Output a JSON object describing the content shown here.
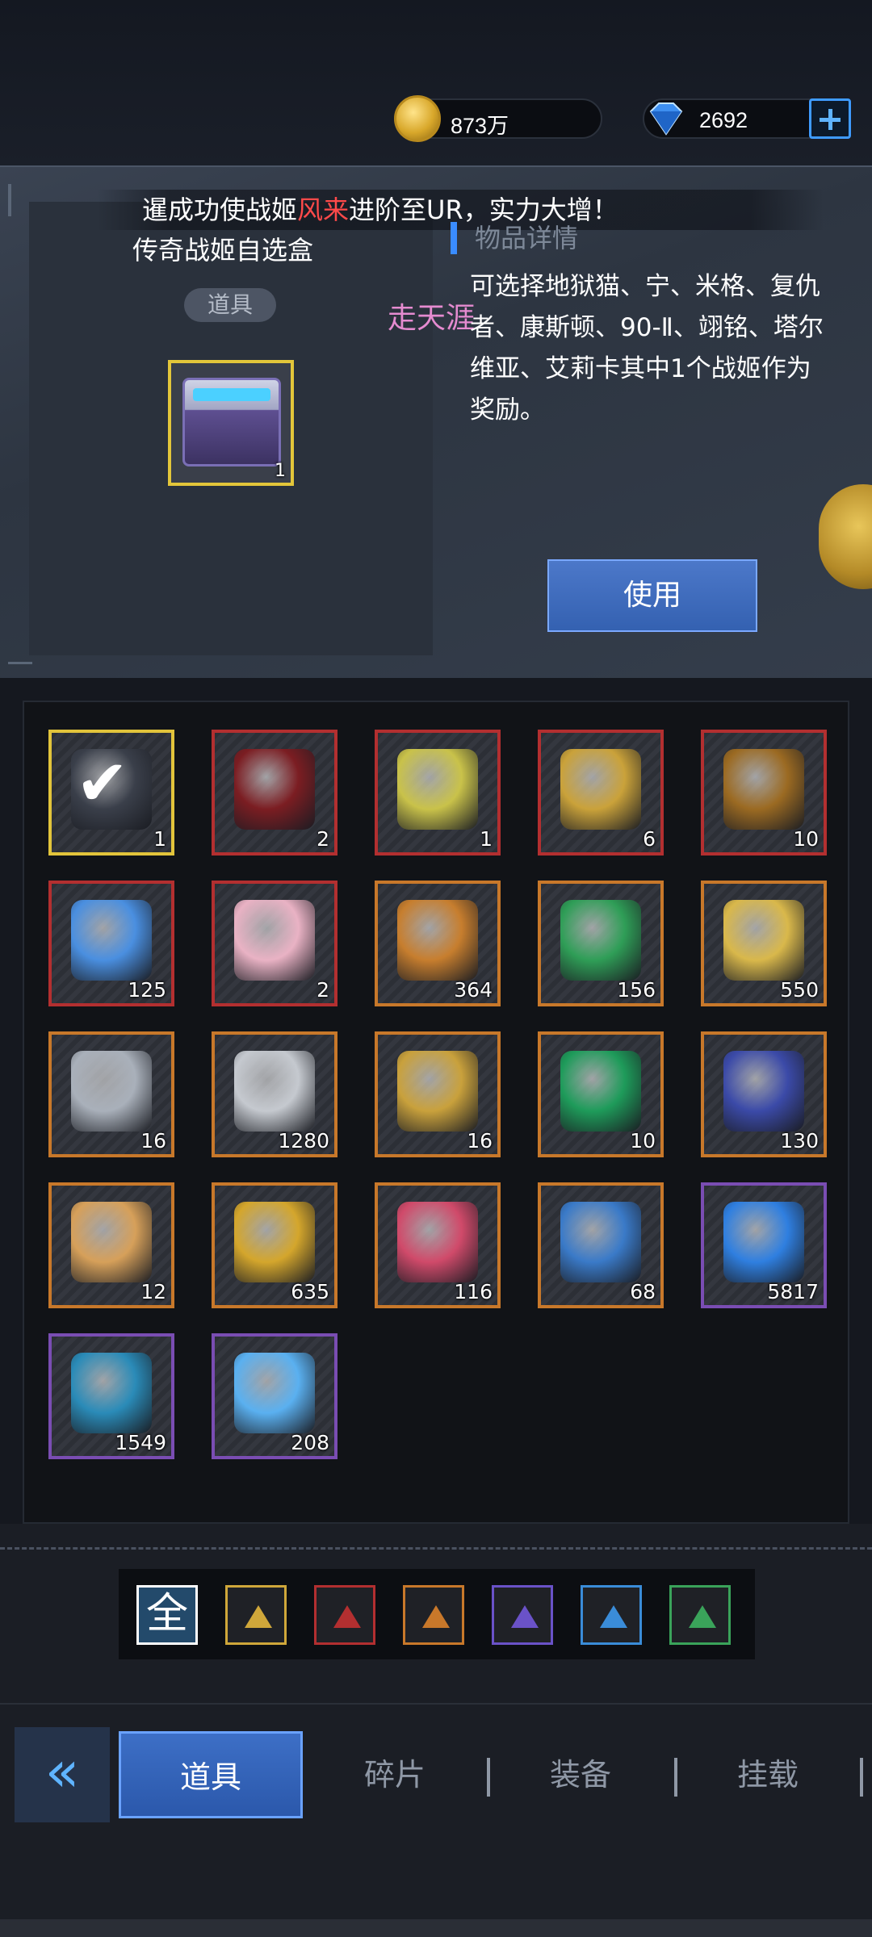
{
  "currency": {
    "gold": "873万",
    "gems": "2692"
  },
  "marquee": {
    "prefix": "暹成功使战姬",
    "highlight": "风来",
    "suffix": "进阶至UR，实力大增！"
  },
  "selected_item": {
    "name": "传奇战姬自选盒",
    "tag": "道具",
    "quantity": "1",
    "detail_heading": "物品详情",
    "description": "可选择地狱猫、宁、米格、复仇者、康斯顿、90-Ⅱ、翊铭、塔尔维亚、艾莉卡其中1个战姬作为奖励。",
    "use_button": "使用"
  },
  "watermark": "走天涯",
  "colors": {
    "accent_blue": "#3a8cff",
    "highlight_red": "#ff4a4a",
    "rarity_yellow": "#e2c43b",
    "rarity_red": "#b32f30",
    "rarity_orange": "#c8782a",
    "rarity_purple": "#7a4db3"
  },
  "inventory": [
    {
      "icon": "chest-selected-icon",
      "qty": "1",
      "rarity": "yellow",
      "color": "#3a3f4a"
    },
    {
      "icon": "red-card-icon",
      "qty": "2",
      "rarity": "red",
      "color": "#7b1d22"
    },
    {
      "icon": "license-ticket-icon",
      "qty": "1",
      "rarity": "red",
      "color": "#c9c24a"
    },
    {
      "icon": "gold-medal-icon",
      "qty": "6",
      "rarity": "red",
      "color": "#caa23a"
    },
    {
      "icon": "fashion-voucher-icon",
      "qty": "10",
      "rarity": "red",
      "color": "#9b6a22"
    },
    {
      "icon": "blue-capsule-icon",
      "qty": "125",
      "rarity": "red",
      "color": "#4a8fe0"
    },
    {
      "icon": "gift-box-icon",
      "qty": "2",
      "rarity": "red",
      "color": "#e9b2c4"
    },
    {
      "icon": "burger-icon",
      "qty": "364",
      "rarity": "orange",
      "color": "#c77e2e"
    },
    {
      "icon": "green-pet-device-icon",
      "qty": "156",
      "rarity": "orange",
      "color": "#2f9e57"
    },
    {
      "icon": "star-badge-icon",
      "qty": "550",
      "rarity": "orange",
      "color": "#d9b84b"
    },
    {
      "icon": "silver-medal-icon",
      "qty": "16",
      "rarity": "orange",
      "color": "#a9b0ba"
    },
    {
      "icon": "shell-stone-icon",
      "qty": "1280",
      "rarity": "orange",
      "color": "#c5c9cf"
    },
    {
      "icon": "blue-gold-coin-icon",
      "qty": "16",
      "rarity": "orange",
      "color": "#c9a13c"
    },
    {
      "icon": "green-crystal-icon",
      "qty": "10",
      "rarity": "orange",
      "color": "#1e9b5a"
    },
    {
      "icon": "gift-coin-icon",
      "qty": "130",
      "rarity": "orange",
      "color": "#3b4aa8"
    },
    {
      "icon": "fried-food-icon",
      "qty": "12",
      "rarity": "orange",
      "color": "#d6a05a"
    },
    {
      "icon": "gold-star-icon",
      "qty": "635",
      "rarity": "orange",
      "color": "#d4a62c"
    },
    {
      "icon": "berry-fruit-icon",
      "qty": "116",
      "rarity": "orange",
      "color": "#d04a6a"
    },
    {
      "icon": "blue-core-icon",
      "qty": "68",
      "rarity": "orange",
      "color": "#3a7ac8"
    },
    {
      "icon": "energy-canister-icon",
      "qty": "5817",
      "rarity": "purple",
      "color": "#2f7fe0"
    },
    {
      "icon": "circuit-board-icon",
      "qty": "1549",
      "rarity": "purple",
      "color": "#2a8bb8"
    },
    {
      "icon": "blue-gem-icon",
      "qty": "208",
      "rarity": "purple",
      "color": "#5ab0f0"
    }
  ],
  "filters": [
    {
      "label": "全",
      "color": "#ffffff"
    },
    {
      "icon": "yellow-filter-icon",
      "color": "#cfa73a"
    },
    {
      "icon": "red-filter-icon",
      "color": "#b32f30"
    },
    {
      "icon": "orange-filter-icon",
      "color": "#c8782a"
    },
    {
      "icon": "purple-filter-icon",
      "color": "#6a52c8"
    },
    {
      "icon": "blue-filter-icon",
      "color": "#3a8cd8"
    },
    {
      "icon": "green-filter-icon",
      "color": "#3aa35a"
    }
  ],
  "tabs": [
    "道具",
    "碎片",
    "装备",
    "挂载"
  ]
}
